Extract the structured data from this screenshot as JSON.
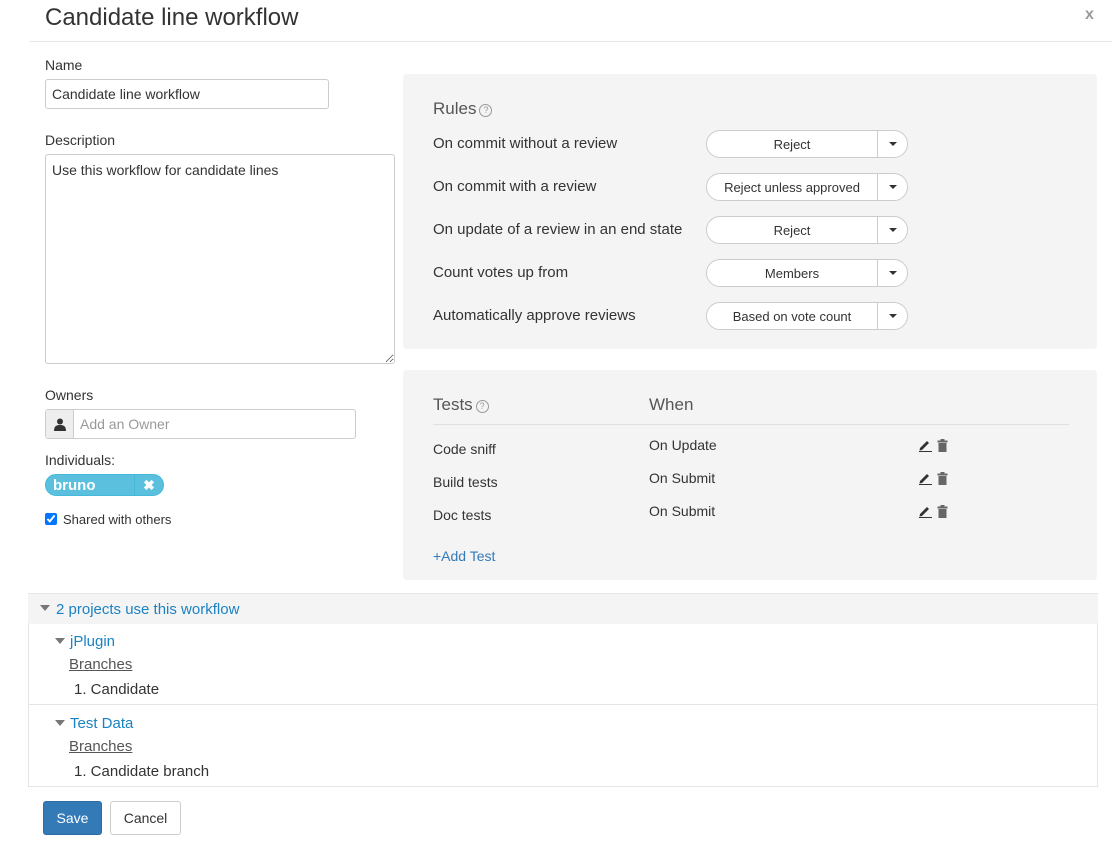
{
  "dialog": {
    "title": "Candidate line workflow",
    "close_label": "x"
  },
  "form": {
    "name_label": "Name",
    "name_value": "Candidate line workflow",
    "description_label": "Description",
    "description_value": "Use this workflow for candidate lines",
    "owners_label": "Owners",
    "owner_placeholder": "Add an Owner",
    "individuals_label": "Individuals:",
    "individuals": [
      "bruno"
    ],
    "shared_label": "Shared with others",
    "shared_checked": true
  },
  "rules": {
    "title": "Rules",
    "help": "?",
    "items": [
      {
        "label": "On commit without a review",
        "value": "Reject"
      },
      {
        "label": "On commit with a review",
        "value": "Reject unless approved"
      },
      {
        "label": "On update of a review in an end state",
        "value": "Reject"
      },
      {
        "label": "Count votes up from",
        "value": "Members"
      },
      {
        "label": "Automatically approve reviews",
        "value": "Based on vote count"
      }
    ]
  },
  "tests": {
    "title": "Tests",
    "help": "?",
    "when_header": "When",
    "items": [
      {
        "name": "Code sniff",
        "when": "On Update"
      },
      {
        "name": "Build tests",
        "when": "On Submit"
      },
      {
        "name": "Doc tests",
        "when": "On Submit"
      }
    ],
    "add_label": "+Add Test"
  },
  "projects": {
    "summary": "2 projects use this workflow",
    "items": [
      {
        "name": "jPlugin",
        "branches_label": "Branches",
        "branches": [
          "1.  Candidate"
        ]
      },
      {
        "name": "Test Data",
        "branches_label": "Branches",
        "branches": [
          "1.  Candidate branch"
        ]
      }
    ]
  },
  "footer": {
    "save_label": "Save",
    "cancel_label": "Cancel"
  },
  "colors": {
    "primary": "#337ab7",
    "link": "#1a82c5",
    "pill": "#5bc0de",
    "panel": "#f4f4f4"
  }
}
